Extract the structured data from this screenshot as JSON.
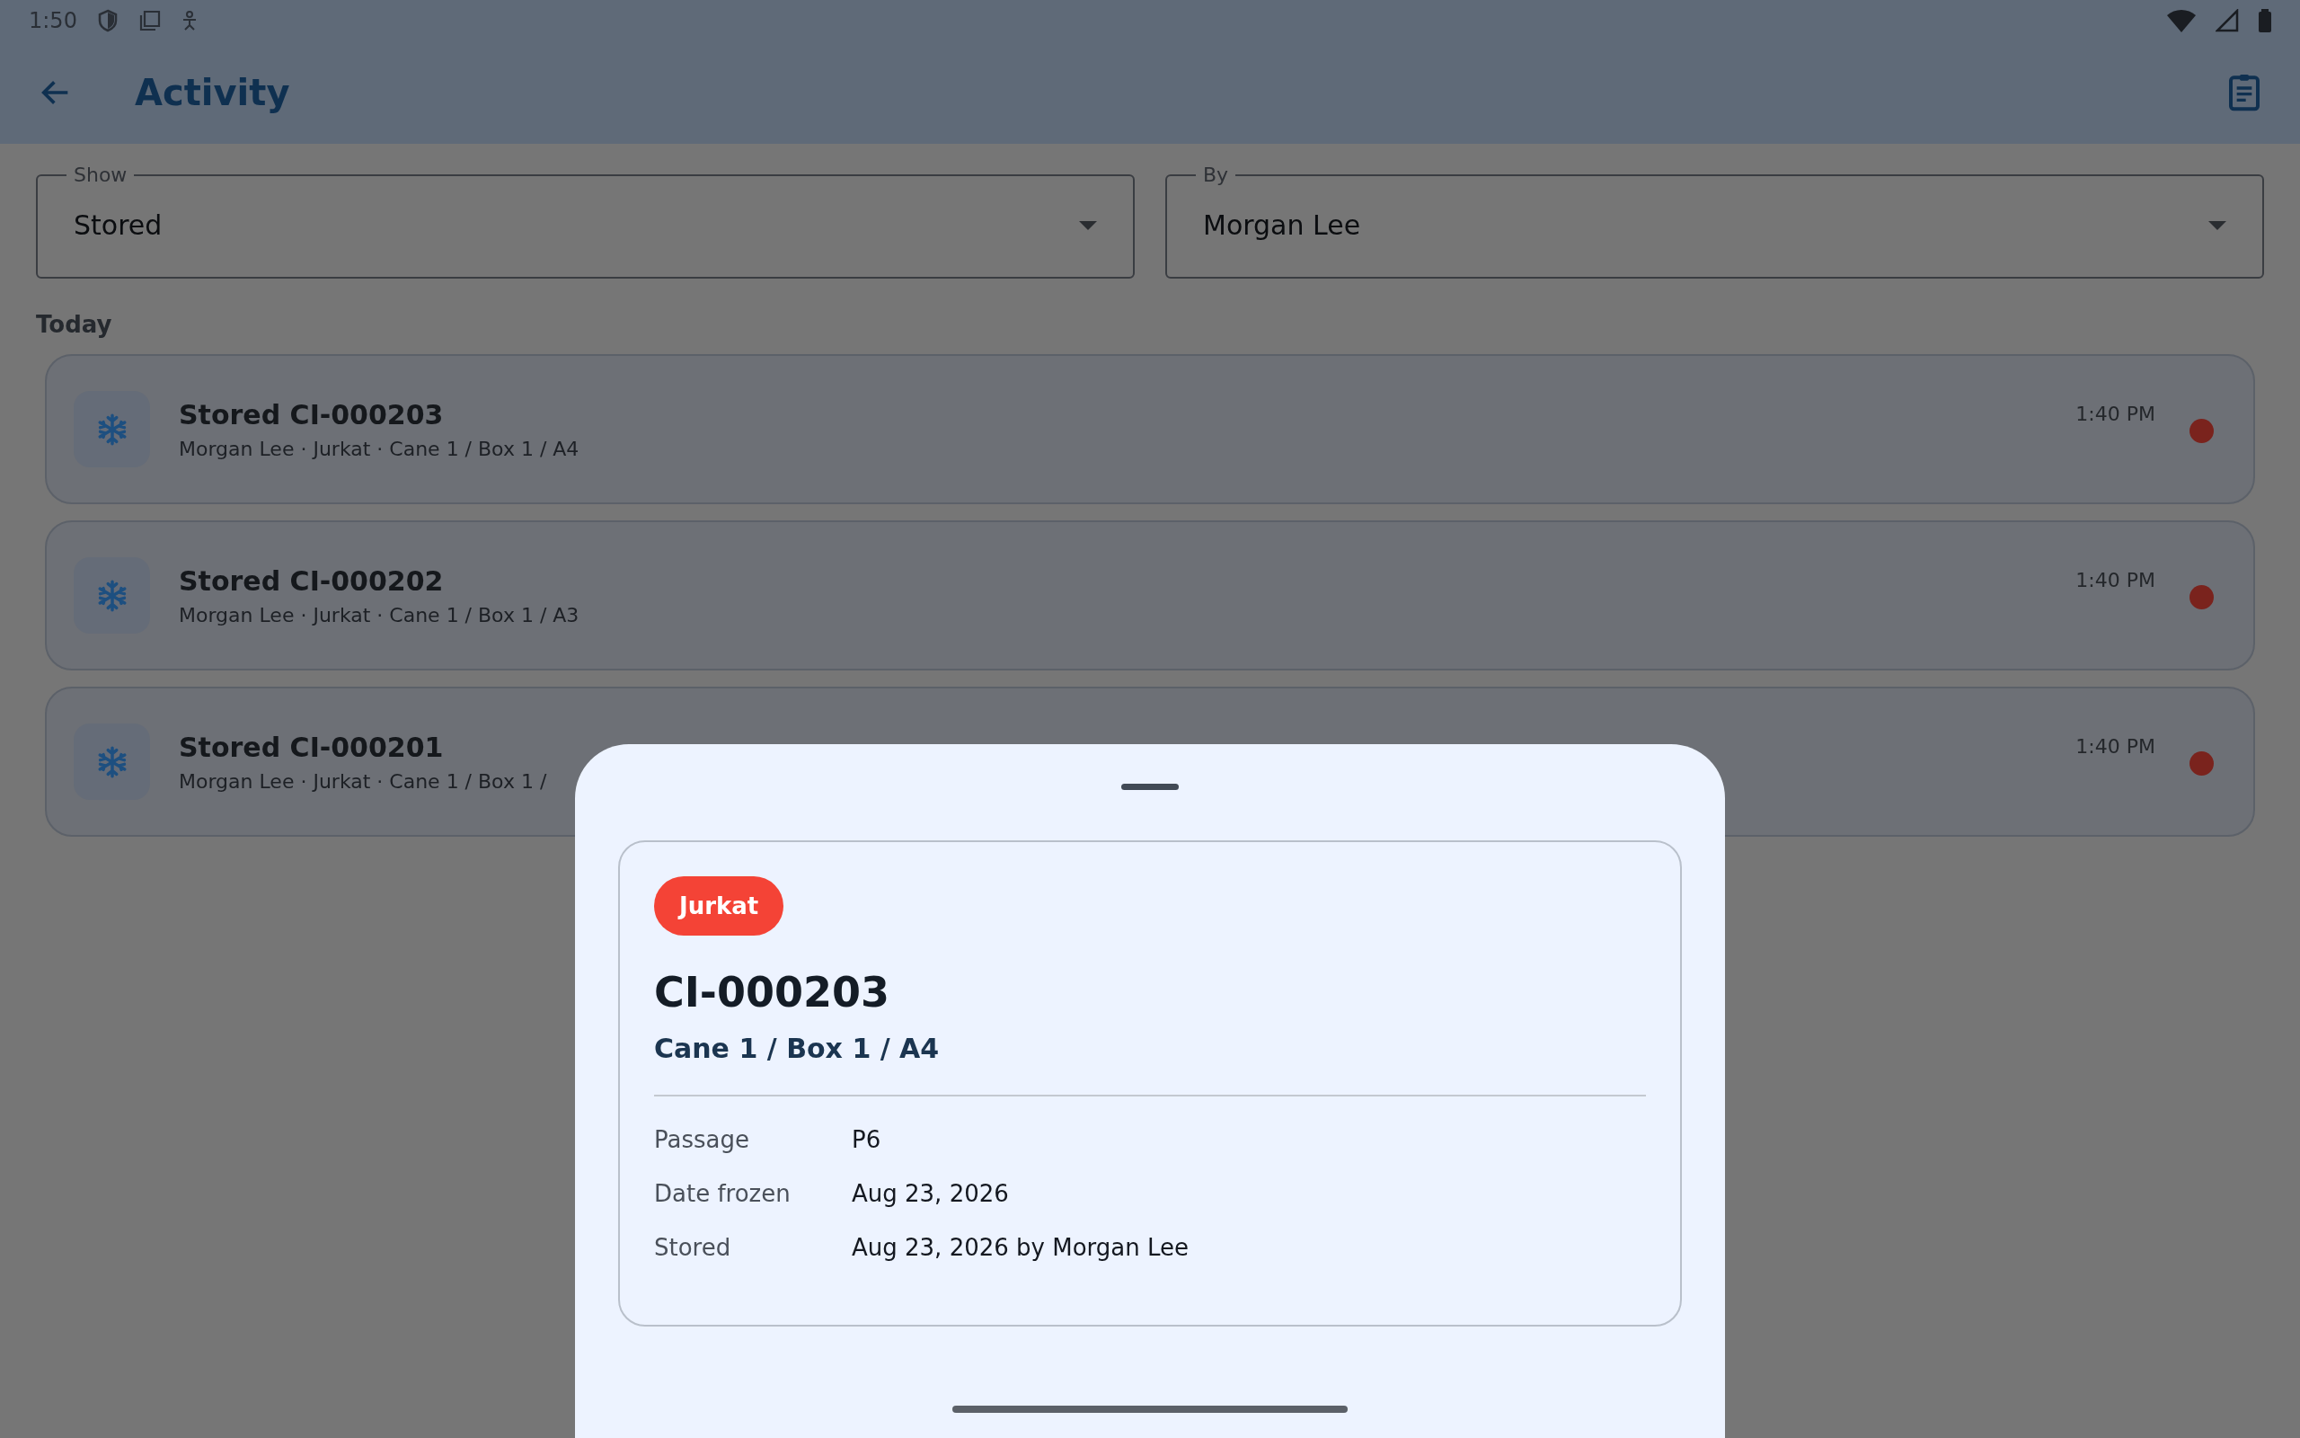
{
  "status_bar": {
    "time": "1:50"
  },
  "app_bar": {
    "title": "Activity"
  },
  "filters": [
    {
      "label": "Show",
      "value": "Stored"
    },
    {
      "label": "By",
      "value": "Morgan Lee"
    }
  ],
  "section_title": "Today",
  "activity_items": [
    {
      "title": "Stored CI-000203",
      "subtitle": "Morgan Lee · Jurkat · Cane 1 / Box 1 / A4",
      "time": "1:40 PM",
      "color": "#7a231d"
    },
    {
      "title": "Stored CI-000202",
      "subtitle": "Morgan Lee · Jurkat · Cane 1 / Box 1 / A3",
      "time": "1:40 PM",
      "color": "#7a231d"
    },
    {
      "title": "Stored CI-000201",
      "subtitle": "Morgan Lee · Jurkat · Cane 1 / Box 1 /",
      "time": "1:40 PM",
      "color": "#7a231d"
    }
  ],
  "sheet": {
    "tag": "Jurkat",
    "id": "CI-000203",
    "location": "Cane 1 / Box 1 / A4",
    "details": [
      {
        "label": "Passage",
        "value": "P6"
      },
      {
        "label": "Date frozen",
        "value": "Aug 23, 2026"
      },
      {
        "label": "Stored",
        "value": "Aug 23, 2026 by Morgan Lee"
      }
    ]
  }
}
